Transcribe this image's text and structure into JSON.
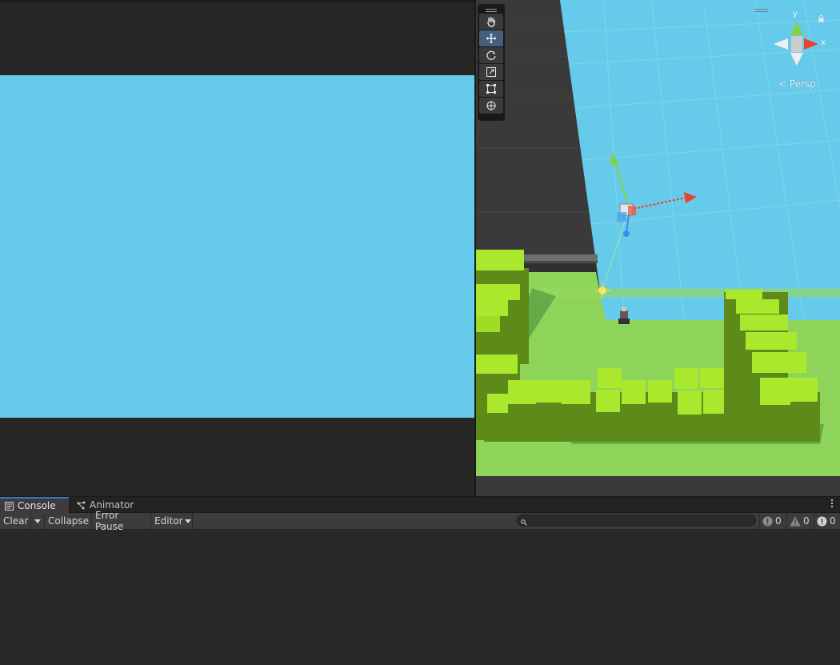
{
  "scene_view": {
    "projection_label": "Persp",
    "gizmo_axes": {
      "y": "y",
      "x": "x"
    },
    "tools": [
      {
        "name": "hand-tool",
        "icon": "hand-icon",
        "active": false
      },
      {
        "name": "move-tool",
        "icon": "move-icon",
        "active": true
      },
      {
        "name": "rotate-tool",
        "icon": "rotate-icon",
        "active": false
      },
      {
        "name": "scale-tool",
        "icon": "scale-icon",
        "active": false
      },
      {
        "name": "rect-tool",
        "icon": "rect-icon",
        "active": false
      },
      {
        "name": "transform-tool",
        "icon": "transform-icon",
        "active": false
      }
    ]
  },
  "console": {
    "tabs": [
      {
        "label": "Console",
        "icon": "console-icon",
        "active": true
      },
      {
        "label": "Animator",
        "icon": "animator-icon",
        "active": false
      }
    ],
    "toolbar": {
      "clear_label": "Clear",
      "collapse_label": "Collapse",
      "error_pause_label": "Error Pause",
      "editor_label": "Editor"
    },
    "search": {
      "value": "",
      "placeholder": ""
    },
    "counters": {
      "info": "0",
      "warnings": "0",
      "errors": "0"
    }
  },
  "colors": {
    "sky": "#66cbeb",
    "grass_light": "#8fd45a",
    "block_top": "#a9e82c",
    "block_side": "#5e8a1a",
    "accent_blue": "#3a79bb",
    "axis_x": "#e8442c",
    "axis_y": "#86d23c",
    "axis_z": "#3c8cf0"
  }
}
